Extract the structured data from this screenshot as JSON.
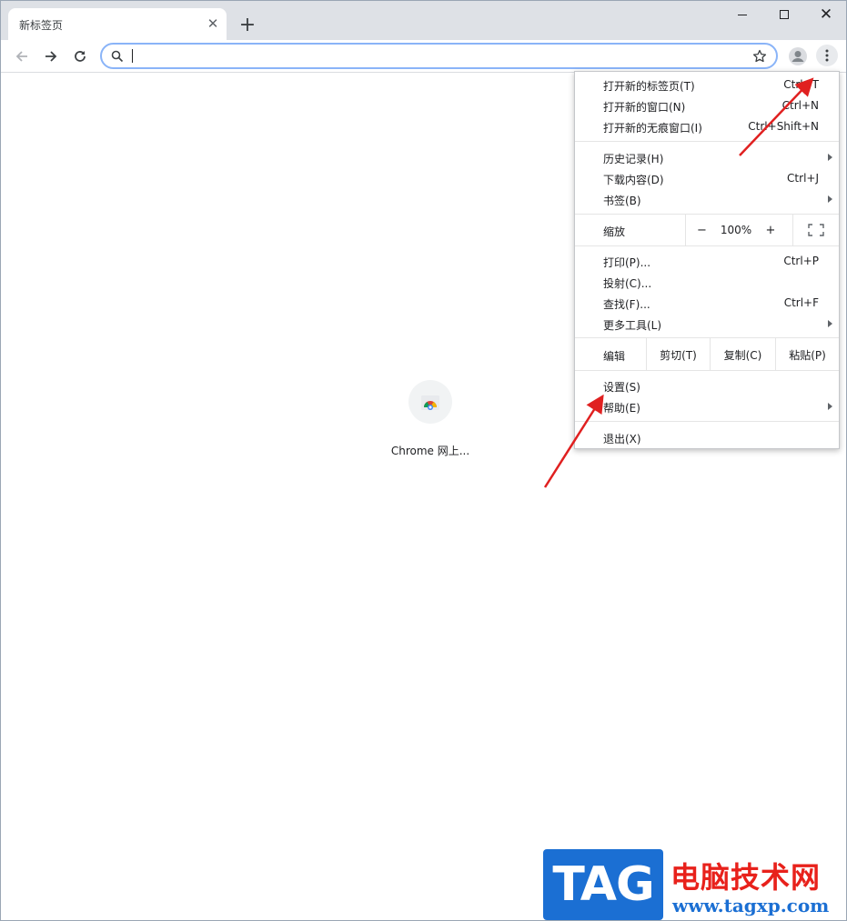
{
  "tab": {
    "title": "新标签页"
  },
  "omnibox": {
    "value": "",
    "placeholder": ""
  },
  "content": {
    "shortcut_label": "Chrome 网上..."
  },
  "menu": {
    "group1": [
      {
        "label": "打开新的标签页(T)",
        "shortcut": "Ctrl+T"
      },
      {
        "label": "打开新的窗口(N)",
        "shortcut": "Ctrl+N"
      },
      {
        "label": "打开新的无痕窗口(I)",
        "shortcut": "Ctrl+Shift+N"
      }
    ],
    "group2": [
      {
        "label": "历史记录(H)",
        "shortcut": ""
      },
      {
        "label": "下载内容(D)",
        "shortcut": "Ctrl+J"
      },
      {
        "label": "书签(B)",
        "shortcut": ""
      }
    ],
    "zoom": {
      "label": "缩放",
      "minus": "−",
      "value": "100%",
      "plus": "+"
    },
    "group3": [
      {
        "label": "打印(P)...",
        "shortcut": "Ctrl+P"
      },
      {
        "label": "投射(C)...",
        "shortcut": ""
      },
      {
        "label": "查找(F)...",
        "shortcut": "Ctrl+F"
      },
      {
        "label": "更多工具(L)",
        "shortcut": ""
      }
    ],
    "edit": {
      "label": "编辑",
      "cut": "剪切(T)",
      "copy": "复制(C)",
      "paste": "粘贴(P)"
    },
    "group4": [
      {
        "label": "设置(S)"
      },
      {
        "label": "帮助(E)"
      }
    ],
    "exit": {
      "label": "退出(X)"
    }
  },
  "watermark": {
    "logo": "TAG",
    "title": "电脑技术网",
    "url": "www.tagxp.com"
  },
  "colors": {
    "accent": "#8ab4f8",
    "arrow": "#e02020",
    "watermark_blue": "#1b6fd3",
    "watermark_red": "#e8211b"
  },
  "icons": [
    "back-icon",
    "forward-icon",
    "reload-icon",
    "search-icon",
    "star-icon",
    "profile-icon",
    "kebab-menu-icon",
    "fullscreen-icon",
    "chrome-web-store-icon"
  ]
}
